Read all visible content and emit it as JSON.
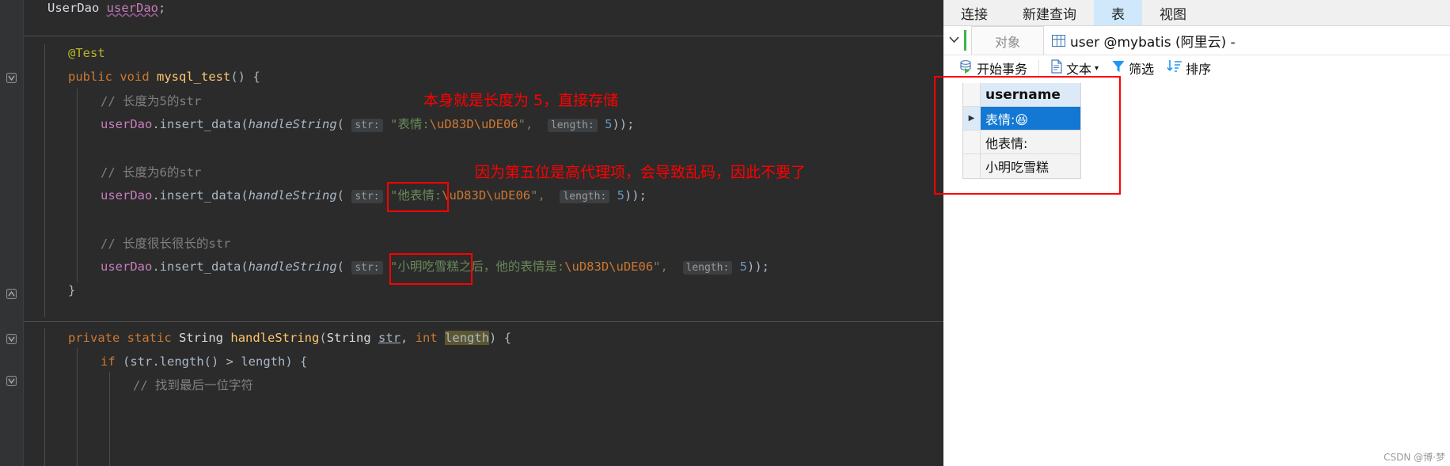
{
  "editor": {
    "lines": [
      {
        "id": "l1",
        "text": "    UserDao userDao;"
      },
      {
        "id": "l2",
        "text": ""
      },
      {
        "id": "l3",
        "text": "    @Test"
      },
      {
        "id": "l4",
        "text": "    public void mysql_test() {"
      },
      {
        "id": "l5",
        "text": "        // 长度为5的str"
      },
      {
        "id": "l6",
        "text": "        userDao.insert_data(handleString( str: \"表情:\\uD83D\\uDE06\",  length: 5));"
      },
      {
        "id": "l7",
        "text": ""
      },
      {
        "id": "l8",
        "text": "        // 长度为6的str"
      },
      {
        "id": "l9",
        "text": "        userDao.insert_data(handleString( str: \"他表情:\\uD83D\\uDE06\",  length: 5));"
      },
      {
        "id": "l10",
        "text": ""
      },
      {
        "id": "l11",
        "text": "        // 长度很长很长的str"
      },
      {
        "id": "l12",
        "text": "        userDao.insert_data(handleString( str: \"小明吃雪糕之后，他的表情是:\\uD83D\\uDE06\",  length: 5));"
      },
      {
        "id": "l13",
        "text": "    }"
      },
      {
        "id": "l14",
        "text": ""
      },
      {
        "id": "l15",
        "text": "    private static String handleString(String str, int length) {"
      },
      {
        "id": "l16",
        "text": "        if (str.length() > length) {"
      },
      {
        "id": "l17",
        "text": "            // 找到最后一位字符"
      }
    ],
    "tokens": {
      "field_type": "UserDao",
      "field_name": "userDao",
      "annotation": "@Test",
      "kw_public": "public",
      "kw_void": "void",
      "method_mysql_test": "mysql_test",
      "comment_len5": "// 长度为5的str",
      "comment_len6": "// 长度为6的str",
      "comment_long": "// 长度很长很长的str",
      "comment_lastchar": "// 找到最后一位字符",
      "call_obj": "userDao",
      "call_method": "insert_data",
      "inner_method": "handleString",
      "hint_str": "str:",
      "hint_length": "length:",
      "str1": "\"表情:",
      "str2": "\"他表情:",
      "str3_boxed": "\"小明吃雪糕",
      "str3_rest": "之后，他的表情是:",
      "escape": "\\uD83D\\uDE06",
      "quote_close": "\",",
      "num5": "5",
      "tail": "));",
      "kw_private": "private",
      "kw_static": "static",
      "kw_String": "String",
      "kw_int": "int",
      "param_str": "str",
      "param_length": "length",
      "kw_if": "if",
      "if_expr": "(str.length() > length) {",
      "brace_close": "}"
    }
  },
  "annotations": {
    "note1": "本身就是长度为 5，直接存储",
    "note2": "因为第五位是高代理项，会导致乱码，因此不要了",
    "color": "#ff0000"
  },
  "navicat": {
    "tabs": [
      {
        "id": "connection",
        "label": "连接",
        "active": false
      },
      {
        "id": "new-query",
        "label": "新建查询",
        "active": false
      },
      {
        "id": "table",
        "label": "表",
        "active": true
      },
      {
        "id": "view",
        "label": "视图",
        "active": false
      }
    ],
    "object_tab": "对象",
    "document_tab": "user @mybatis (阿里云) -",
    "toolbar": [
      {
        "id": "begin-transaction",
        "label": "开始事务",
        "icon": "database-play-icon"
      },
      {
        "id": "text",
        "label": "文本",
        "icon": "document-icon",
        "caret": "▾"
      },
      {
        "id": "filter",
        "label": "筛选",
        "icon": "funnel-icon"
      },
      {
        "id": "sort",
        "label": "排序",
        "icon": "sort-down-icon"
      }
    ],
    "grid": {
      "columns": [
        "username"
      ],
      "rows": [
        {
          "marker": "▶",
          "selected": true,
          "username": "表情:😆"
        },
        {
          "marker": "",
          "selected": false,
          "username": "他表情:"
        },
        {
          "marker": "",
          "selected": false,
          "username": "小明吃雪糕"
        }
      ]
    }
  },
  "watermark": "CSDN @博·梦"
}
